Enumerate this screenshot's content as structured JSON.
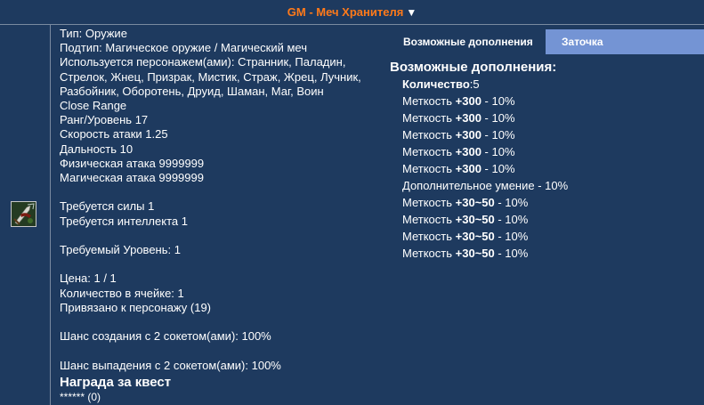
{
  "header": {
    "title": "GM - Меч Хранителя",
    "caret": "▼"
  },
  "item": {
    "icon": "sword-item-icon",
    "lines": [
      "Тип: Оружие",
      "Подтип: Магическое оружие / Магический меч",
      "Используется персонажем(ами): Странник, Паладин,",
      "Стрелок, Жнец, Призрак, Мистик, Страж, Жрец, Лучник,",
      "Разбойник, Оборотень, Друид, Шаман, Маг, Воин",
      "Close Range",
      "Ранг/Уровень 17",
      "Скорость атаки 1.25",
      "Дальность 10",
      "Физическая атака 9999999",
      "Магическая атака 9999999"
    ],
    "requirements": [
      "Требуется силы 1",
      "Требуется интеллекта 1"
    ],
    "required_level": "Требуемый Уровень: 1",
    "info": [
      "Цена: 1 / 1",
      "Количество в ячейке: 1",
      "Привязано к персонажу (19)"
    ],
    "craft_chance": "Шанс создания с 2 сокетом(ами): 100%",
    "drop_chance": "Шанс выпадения с 2 сокетом(ами): 100%",
    "quest_reward_title": "Награда за квест",
    "quest_reward_value": "****** (0)"
  },
  "tabs": {
    "possible_addons": "Возможные дополнения",
    "sharpening": "Заточка"
  },
  "addons": {
    "heading": "Возможные дополнения:",
    "count_label": "Количество",
    "count_value": ":5",
    "rows": [
      {
        "pre": "Меткость ",
        "val": "+300",
        "post": " - 10%"
      },
      {
        "pre": "Меткость ",
        "val": "+300",
        "post": " - 10%"
      },
      {
        "pre": "Меткость ",
        "val": "+300",
        "post": " - 10%"
      },
      {
        "pre": "Меткость ",
        "val": "+300",
        "post": " - 10%"
      },
      {
        "pre": "Меткость ",
        "val": "+300",
        "post": " - 10%"
      },
      {
        "pre": "Дополнительное умение - 10%",
        "val": "",
        "post": ""
      },
      {
        "pre": "Меткость ",
        "val": "+30~50",
        "post": " - 10%"
      },
      {
        "pre": "Меткость ",
        "val": "+30~50",
        "post": " - 10%"
      },
      {
        "pre": "Меткость ",
        "val": "+30~50",
        "post": " - 10%"
      },
      {
        "pre": "Меткость ",
        "val": "+30~50",
        "post": " - 10%"
      }
    ]
  }
}
